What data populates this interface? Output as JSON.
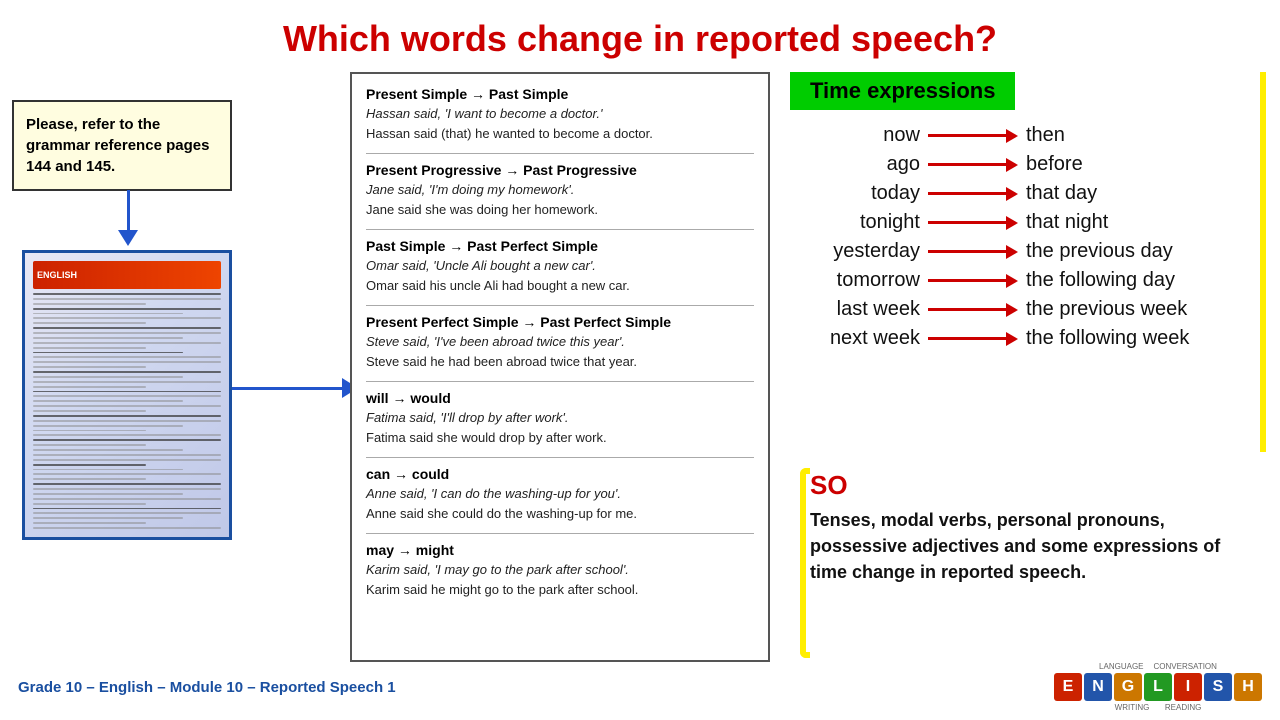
{
  "title": "Which words change in reported speech?",
  "grammar_box": {
    "text": "Please, refer to the grammar reference pages 144 and 145."
  },
  "examples": [
    {
      "title": "Present Simple → Past Simple",
      "lines": [
        "Hassan said, 'I want to become a doctor.'",
        "Hassan said (that) he wanted to become a doctor."
      ]
    },
    {
      "title": "Present Progressive → Past Progressive",
      "lines": [
        "Jane said, 'I'm doing my homework'.",
        "Jane said she was doing her homework."
      ]
    },
    {
      "title": "Past Simple → Past Perfect Simple",
      "lines": [
        "Omar said, 'Uncle Ali bought a new car'.",
        "Omar said his uncle Ali had bought a new car."
      ]
    },
    {
      "title": "Present Perfect Simple → Past Perfect Simple",
      "lines": [
        "Steve said, 'I've been abroad twice this year'.",
        "Steve said he had been abroad twice that year."
      ]
    },
    {
      "title": "will → would",
      "lines": [
        "Fatima said, 'I'll drop by after work'.",
        "Fatima said she would drop by after work."
      ]
    },
    {
      "title": "can → could",
      "lines": [
        "Anne said, 'I can do the washing-up for you'.",
        "Anne said she could do the washing-up for me."
      ]
    },
    {
      "title": "may → might",
      "lines": [
        "Karim said, 'I may go to the park after school'.",
        "Karim said he might go to the park after school."
      ]
    }
  ],
  "time_expressions": {
    "header": "Time expressions",
    "rows": [
      {
        "left": "now",
        "right": "then"
      },
      {
        "left": "ago",
        "right": "before"
      },
      {
        "left": "today",
        "right": "that day"
      },
      {
        "left": "tonight",
        "right": "that night"
      },
      {
        "left": "yesterday",
        "right": "the previous day"
      },
      {
        "left": "tomorrow",
        "right": "the following day"
      },
      {
        "left": "last week",
        "right": "the previous week"
      },
      {
        "left": "next week",
        "right": "the following week"
      }
    ]
  },
  "so_section": {
    "word": "SO",
    "text": "Tenses, modal verbs, personal pronouns, possessive adjectives and some expressions of time change in reported speech."
  },
  "footer": {
    "text": "Grade 10 – English – Module 10 – Reported Speech 1"
  },
  "logo": {
    "letters": [
      "E",
      "N",
      "G",
      "L",
      "I",
      "S",
      "H"
    ],
    "colors": [
      "#cc2200",
      "#2255aa",
      "#cc7700",
      "#229922",
      "#cc2200",
      "#2255aa",
      "#cc7700"
    ]
  }
}
